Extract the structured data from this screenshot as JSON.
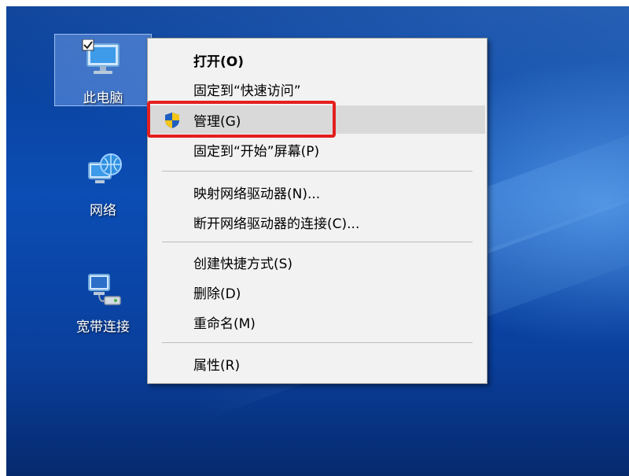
{
  "desktop": {
    "icons": [
      {
        "label": "此电脑",
        "icon": "computer-icon"
      },
      {
        "label": "网络",
        "icon": "network-icon"
      },
      {
        "label": "宽带连接",
        "icon": "broadband-connection-icon"
      }
    ]
  },
  "context_menu": {
    "items": [
      {
        "label": "打开(O)"
      },
      {
        "label": "固定到“快速访问”"
      },
      {
        "label": "管理(G)",
        "icon": "uac-shield-icon"
      },
      {
        "label": "固定到“开始”屏幕(P)"
      },
      {
        "label": "映射网络驱动器(N)..."
      },
      {
        "label": "断开网络驱动器的连接(C)..."
      },
      {
        "label": "创建快捷方式(S)"
      },
      {
        "label": "删除(D)"
      },
      {
        "label": "重命名(M)"
      },
      {
        "label": "属性(R)"
      }
    ]
  },
  "colors": {
    "annotation_box": "#e41f1f",
    "desktop_blue": "#0b4db4",
    "menu_background": "#f2f2f2",
    "menu_hover": "#d9d9d9"
  }
}
